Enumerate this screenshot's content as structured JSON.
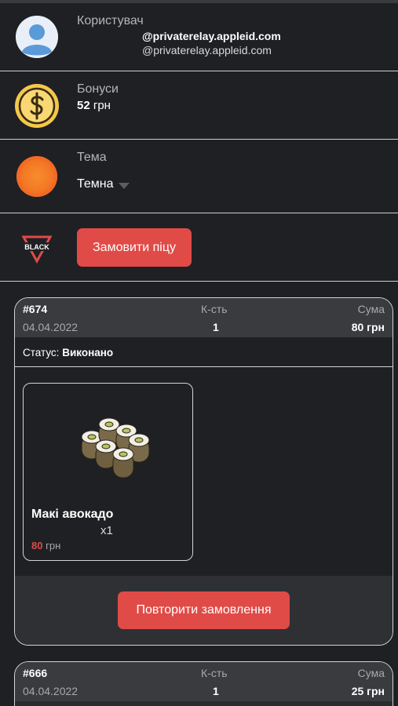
{
  "profile": {
    "user_label": "Користувач",
    "email_primary": "@privaterelay.appleid.com",
    "email_secondary": "@privaterelay.appleid.com",
    "bonus_label": "Бонуси",
    "bonus_amount": "52",
    "bonus_currency": "грн",
    "theme_label": "Тема",
    "theme_value": "Темна",
    "order_pizza_button": "Замовити піцу",
    "logo_text": "BLACK"
  },
  "orders": [
    {
      "number": "#674",
      "date": "04.04.2022",
      "qty_header": "К-сть",
      "qty": "1",
      "sum_header": "Сума",
      "sum": "80 грн",
      "status_label": "Статус:",
      "status_value": "Виконано",
      "item": {
        "name": "Макі авокадо",
        "qty": "x1",
        "price": "80",
        "currency": "грн"
      },
      "repeat_button": "Повторити замовлення"
    },
    {
      "number": "#666",
      "date": "04.04.2022",
      "qty_header": "К-сть",
      "qty": "1",
      "sum_header": "Сума",
      "sum": "25 грн"
    }
  ],
  "colors": {
    "background": "#1f2023",
    "accent": "#e04b47",
    "divider": "#cfd0d3"
  }
}
